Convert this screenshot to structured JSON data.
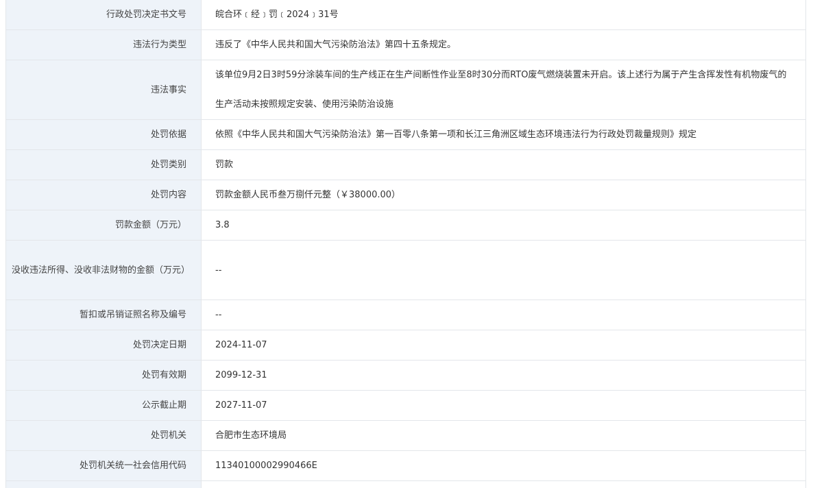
{
  "rows": [
    {
      "label": "行政处罚决定书文号",
      "value": "皖合环﹝经﹞罚﹝2024﹞31号"
    },
    {
      "label": "违法行为类型",
      "value": "违反了《中华人民共和国大气污染防治法》第四十五条规定。"
    },
    {
      "label": "违法事实",
      "value_lines": [
        "该单位9月2日3时59分涂装车间的生产线正在生产间断性作业至8时30分而RTO废气燃烧装置未开启。该上述行为属于产生含挥发性有机物废气的",
        "生产活动未按照规定安装、使用污染防治设施"
      ]
    },
    {
      "label": "处罚依据",
      "value": "依照《中华人民共和国大气污染防治法》第一百零八条第一项和长江三角洲区域生态环境违法行为行政处罚裁量规则》规定"
    },
    {
      "label": "处罚类别",
      "value": "罚款"
    },
    {
      "label": "处罚内容",
      "value": "罚款金额人民币叁万捌仟元整（￥38000.00）"
    },
    {
      "label": "罚款金额（万元）",
      "value": "3.8"
    },
    {
      "label": "没收违法所得、没收非法财物的金额（万元）",
      "value": "--"
    },
    {
      "label": "暂扣或吊销证照名称及编号",
      "value": "--"
    },
    {
      "label": "处罚决定日期",
      "value": "2024-11-07"
    },
    {
      "label": "处罚有效期",
      "value": "2099-12-31"
    },
    {
      "label": "公示截止期",
      "value": "2027-11-07"
    },
    {
      "label": "处罚机关",
      "value": "合肥市生态环境局"
    },
    {
      "label": "处罚机关统一社会信用代码",
      "value": "11340100002990466E"
    },
    {
      "label": "",
      "value": ""
    }
  ]
}
